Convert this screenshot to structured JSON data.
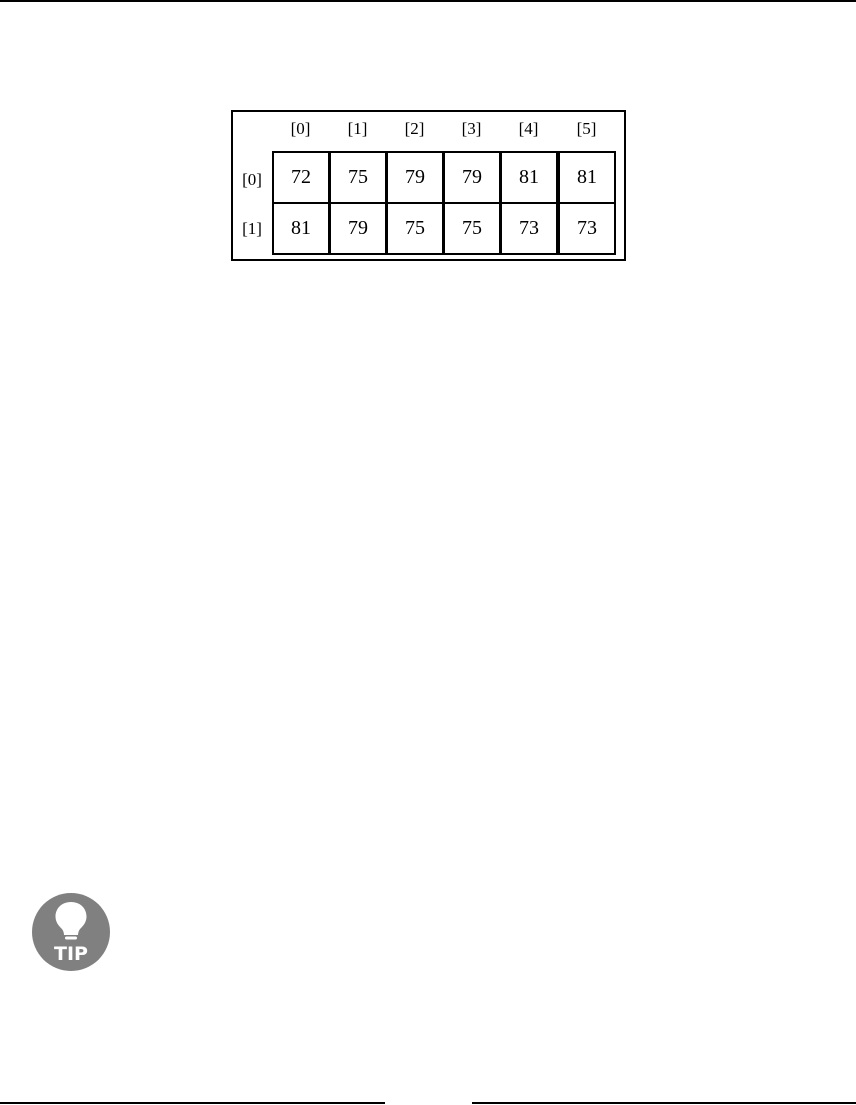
{
  "array_figure": {
    "column_indices": [
      "[0]",
      "[1]",
      "[2]",
      "[3]",
      "[4]",
      "[5]"
    ],
    "row_indices": [
      "[0]",
      "[1]"
    ],
    "rows": [
      [
        "72",
        "75",
        "79",
        "79",
        "81",
        "81"
      ],
      [
        "81",
        "79",
        "75",
        "75",
        "73",
        "73"
      ]
    ]
  },
  "tip": {
    "icon": "lightbulb-icon",
    "label": "TIP",
    "colors": {
      "badge": "#808080",
      "glyph": "#ffffff"
    }
  }
}
